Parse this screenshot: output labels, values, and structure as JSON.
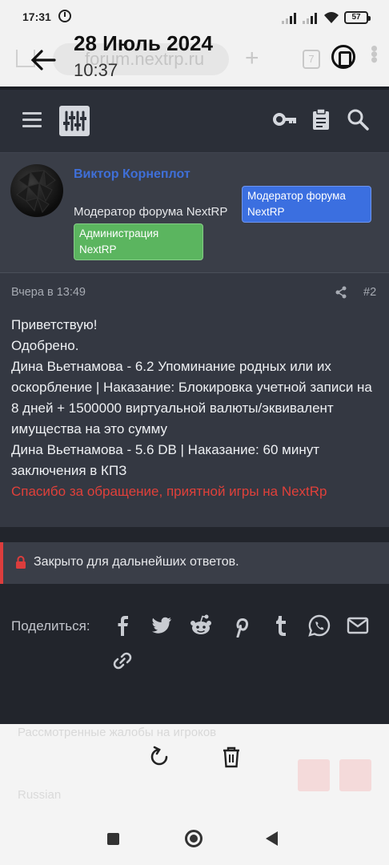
{
  "status_bar": {
    "time": "17:31",
    "battery": "57"
  },
  "browser": {
    "url_ghost": "forum.nextrp.ru",
    "tab_count": "7",
    "overlay_date": "28 Июль 2024",
    "overlay_time": "10:37"
  },
  "post": {
    "username": "Виктор Корнеплот",
    "user_title": "Модератор форума NextRP",
    "badges": [
      "Модератор форума NextRP",
      "Администрация NextRP"
    ],
    "date": "Вчера в 13:49",
    "number": "#2",
    "body": [
      "Приветствую!",
      "Одобрено.",
      "Дина Вьетнамова - 6.2 Упоминание родных или их оскорбление | Наказание: Блокировка учетной записи на 8 дней + 1500000 виртуальной валюты/эквивалент имущества на это сумму",
      "Дина Вьетнамова - 5.6 DB | Наказание: 60 минут заключения в КПЗ"
    ],
    "closing_red": "Спасибо за обращение, приятной игры на NextRp"
  },
  "thread_closed": "Закрыто для дальнейших ответов.",
  "share": {
    "label": "Поделиться:",
    "icons": [
      "facebook-icon",
      "twitter-icon",
      "reddit-icon",
      "pinterest-icon",
      "tumblr-icon",
      "whatsapp-icon",
      "email-icon",
      "link-icon"
    ]
  },
  "footer": {
    "breadcrumb_ghost": "Рассмотренные жалобы на игроков",
    "language_ghost": "Russian"
  },
  "colors": {
    "username": "#3f6fd8",
    "badge_moderator": "#3b6fe0",
    "badge_admin": "#5bb55f",
    "closing_text": "#e0403a",
    "closed_bar_accent": "#dc3d3d"
  }
}
